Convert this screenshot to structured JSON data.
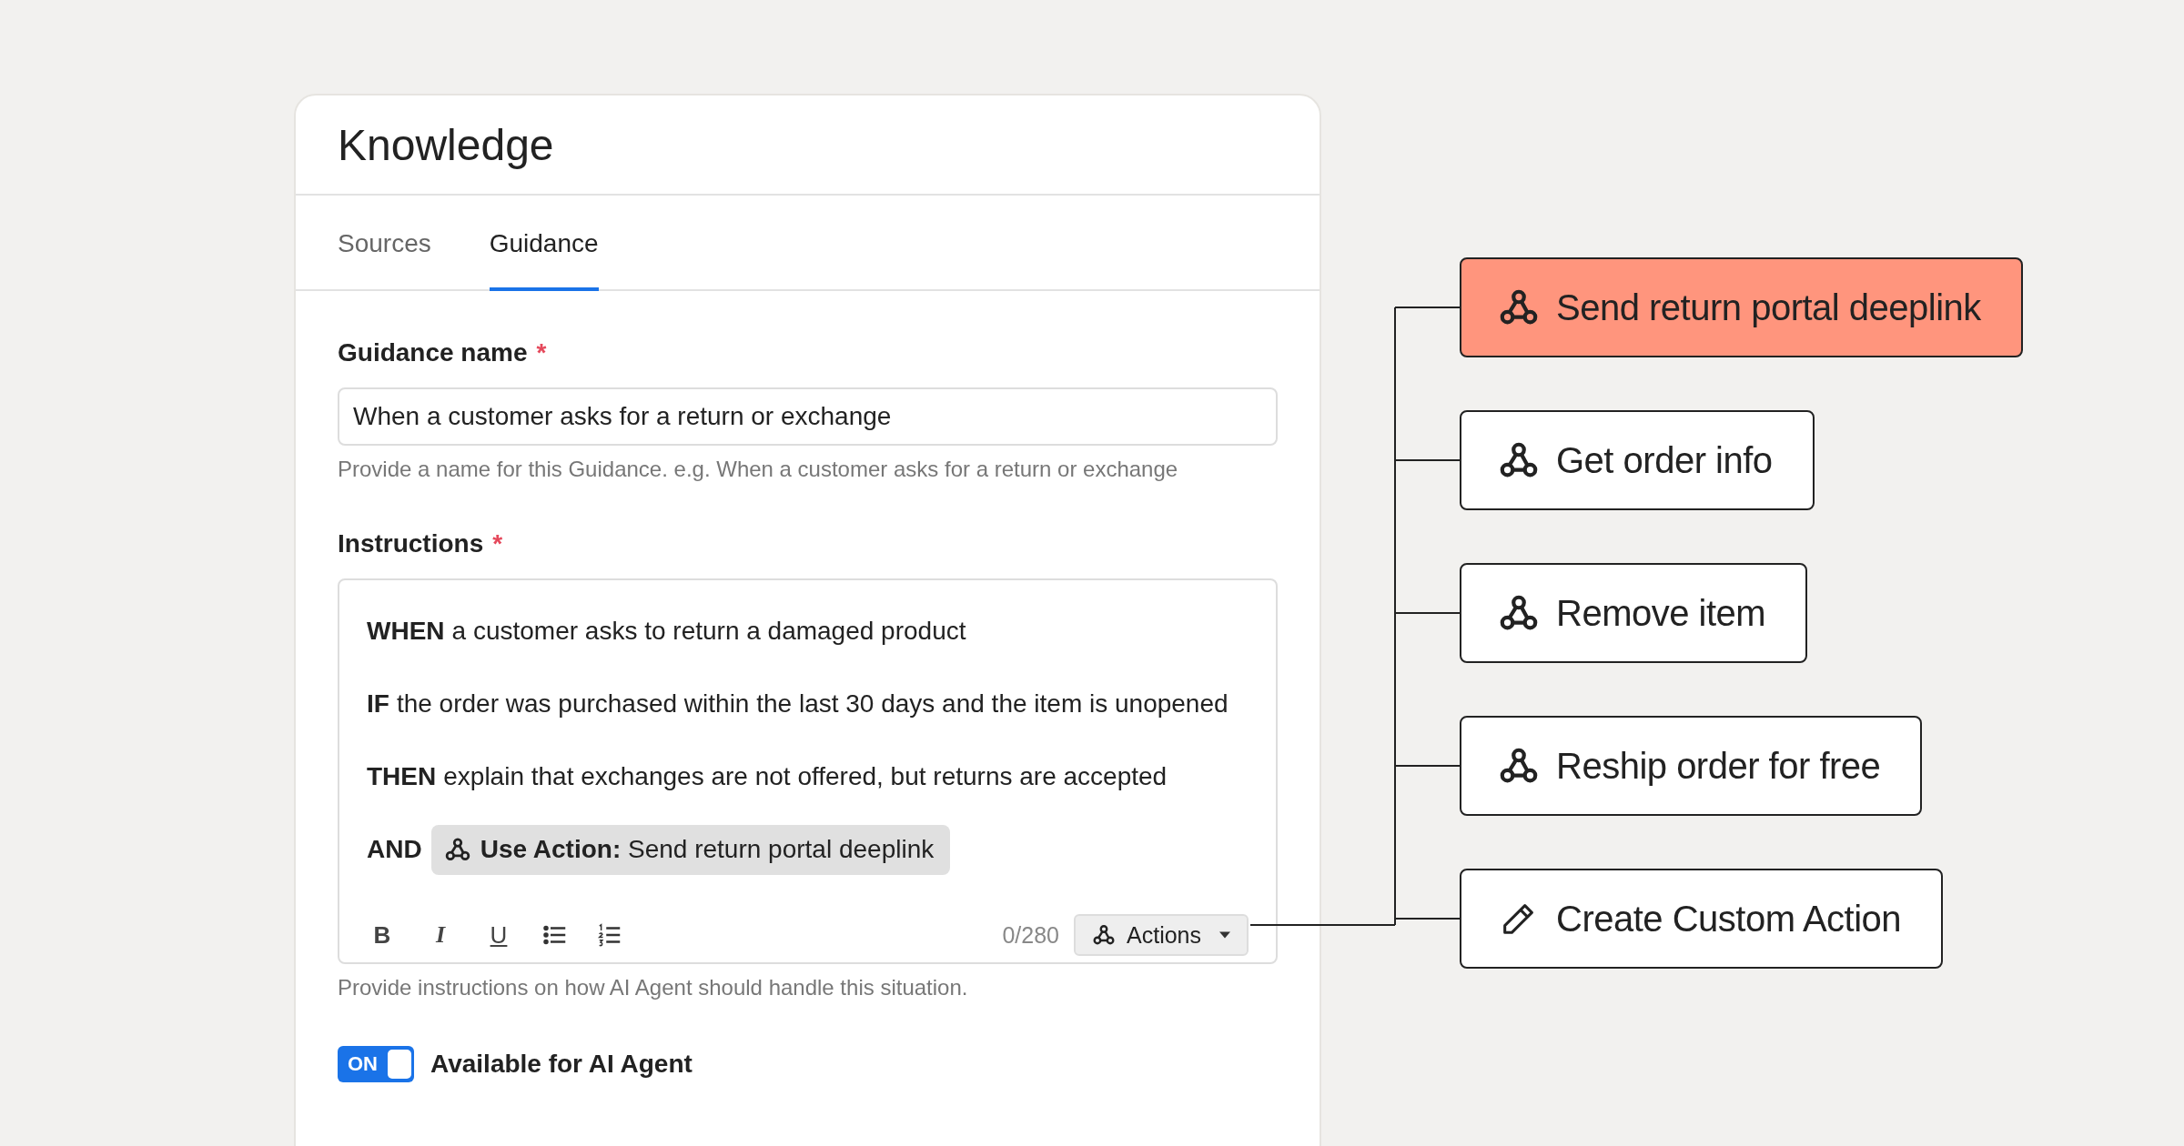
{
  "card": {
    "title": "Knowledge",
    "tabs": [
      {
        "label": "Sources",
        "selected": false
      },
      {
        "label": "Guidance",
        "selected": true
      }
    ],
    "name_field": {
      "label": "Guidance name",
      "required_mark": "*",
      "value": "When a customer asks for a return or exchange",
      "hint": "Provide a name for this Guidance. e.g. When a customer asks for a return or exchange"
    },
    "instructions": {
      "label": "Instructions",
      "required_mark": "*",
      "lines": [
        {
          "kind": "text",
          "keyword": "WHEN",
          "text": "a customer asks to return a damaged product"
        },
        {
          "kind": "text",
          "keyword": "IF",
          "text": "the order was purchased within the last 30 days and the item is unopened"
        },
        {
          "kind": "text",
          "keyword": "THEN",
          "text": "explain that exchanges are not offered, but returns are accepted"
        },
        {
          "kind": "action",
          "keyword": "AND",
          "chip_label": "Use Action:",
          "chip_value": "Send return portal deeplink"
        }
      ],
      "toolbar": [
        {
          "kind": "bold",
          "label": "B"
        },
        {
          "kind": "italic",
          "label": "I"
        },
        {
          "kind": "underline",
          "label": "U"
        },
        {
          "kind": "bullets"
        },
        {
          "kind": "numbers"
        }
      ],
      "counter": "0/280",
      "actions_button": "Actions",
      "hint": "Provide instructions on how AI Agent should handle this situation."
    },
    "toggle": {
      "on": true,
      "state_label": "ON",
      "label": "Available for AI Agent"
    }
  },
  "actions_menu": [
    {
      "kind": "webhook",
      "label": "Send return portal deeplink",
      "selected": true
    },
    {
      "kind": "webhook",
      "label": "Get order info",
      "selected": false
    },
    {
      "kind": "webhook",
      "label": "Remove item",
      "selected": false
    },
    {
      "kind": "webhook",
      "label": "Reship order for free",
      "selected": false
    },
    {
      "kind": "create",
      "label": "Create Custom Action",
      "selected": false
    }
  ]
}
